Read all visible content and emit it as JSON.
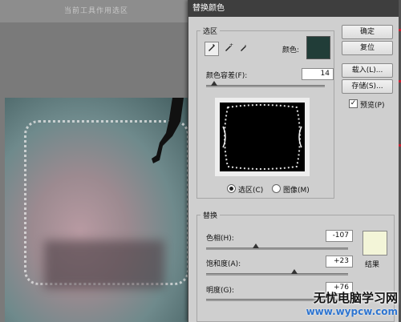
{
  "workspace": {
    "title": "当前工具作用选区"
  },
  "dialog": {
    "title": "替换颜色",
    "selection_group": "选区",
    "color_label": "颜色:",
    "fuzziness_label": "颜色容差(F):",
    "fuzziness_value": "14",
    "fuzziness_level": 0.07,
    "radio_selection": "选区(C)",
    "radio_image": "图像(M)",
    "replace_group": "替换",
    "hue_label": "色相(H):",
    "hue_value": "-107",
    "hue_level": 0.35,
    "sat_label": "饱和度(A):",
    "sat_value": "+23",
    "sat_level": 0.62,
    "light_label": "明度(G):",
    "light_value": "+76",
    "light_level": 0.88,
    "result_label": "结果",
    "buttons": {
      "ok": "确定",
      "reset": "复位",
      "load": "载入(L)...",
      "save": "存储(S)..."
    },
    "preview_label": "预览(P)",
    "colors": {
      "selected_color": "#213d38",
      "result_color": "#f3f5d8"
    }
  },
  "watermark": {
    "line1": "无忧电脑学习网",
    "line2": "www.wypcw.com"
  }
}
